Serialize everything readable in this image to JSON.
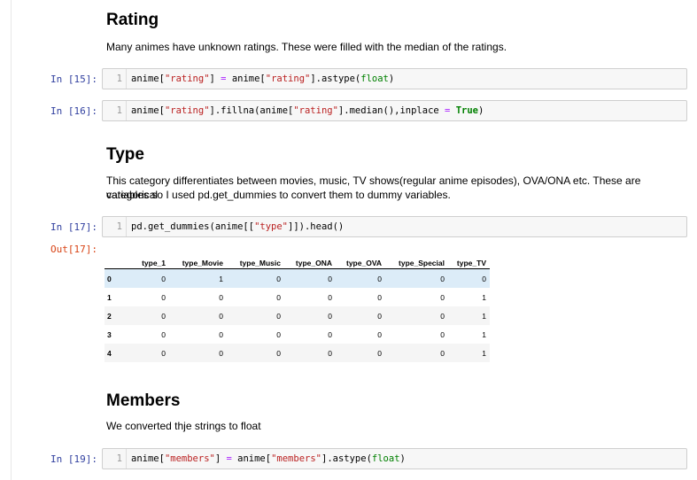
{
  "sections": {
    "rating": {
      "heading": "Rating",
      "text": "Many animes have unknown ratings. These were filled with the median of the ratings."
    },
    "type": {
      "heading": "Type",
      "text_line1": "This category differentiates between movies, music, TV shows(regular anime episodes), OVA/ONA etc. These are categorical",
      "text_line2": "variables so I used pd.get_dummies to convert them to dummy variables."
    },
    "members": {
      "heading": "Members",
      "text": "We converted thje strings to float"
    }
  },
  "cells": [
    {
      "prompt": "In [15]:",
      "line_no": "1",
      "code": {
        "p1": "anime[",
        "s1": "\"rating\"",
        "p2": "] ",
        "op": "=",
        "p3": " anime[",
        "s2": "\"rating\"",
        "p4": "].astype(",
        "b1": "float",
        "p5": ")"
      }
    },
    {
      "prompt": "In [16]:",
      "line_no": "1",
      "code": {
        "p1": "anime[",
        "s1": "\"rating\"",
        "p2": "].fillna(anime[",
        "s2": "\"rating\"",
        "p3": "].median(),inplace ",
        "op": "=",
        "p4": " ",
        "k1": "True",
        "p5": ")"
      }
    },
    {
      "prompt": "In [17]:",
      "line_no": "1",
      "code": {
        "p1": "pd.get_dummies(anime[[",
        "s1": "\"type\"",
        "p2": "]]).head()"
      }
    },
    {
      "prompt": "In [19]:",
      "line_no": "1",
      "code": {
        "p1": "anime[",
        "s1": "\"members\"",
        "p2": "] ",
        "op": "=",
        "p3": " anime[",
        "s2": "\"members\"",
        "p4": "].astype(",
        "b1": "float",
        "p5": ")"
      }
    }
  ],
  "output": {
    "prompt": "Out[17]:",
    "columns": [
      "",
      "type_1",
      "type_Movie",
      "type_Music",
      "type_ONA",
      "type_OVA",
      "type_Special",
      "type_TV"
    ],
    "rows": [
      [
        "0",
        "0",
        "1",
        "0",
        "0",
        "0",
        "0",
        "0"
      ],
      [
        "1",
        "0",
        "0",
        "0",
        "0",
        "0",
        "0",
        "1"
      ],
      [
        "2",
        "0",
        "0",
        "0",
        "0",
        "0",
        "0",
        "1"
      ],
      [
        "3",
        "0",
        "0",
        "0",
        "0",
        "0",
        "0",
        "1"
      ],
      [
        "4",
        "0",
        "0",
        "0",
        "0",
        "0",
        "0",
        "1"
      ]
    ]
  }
}
